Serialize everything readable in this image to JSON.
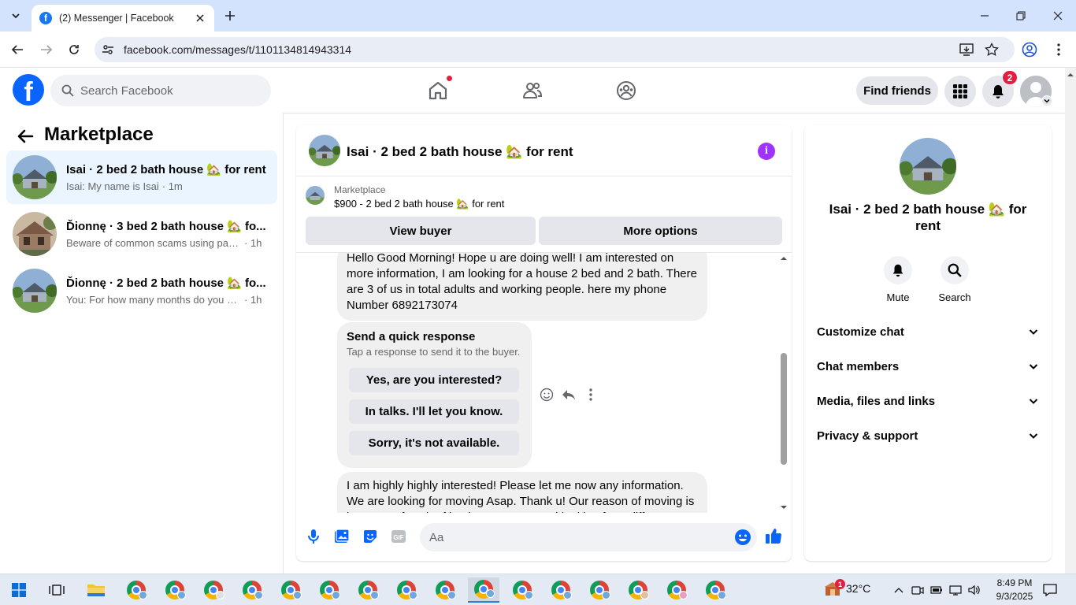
{
  "browser": {
    "tab_title": "(2) Messenger | Facebook",
    "url": "facebook.com/messages/t/1101134814943314"
  },
  "fb_header": {
    "search_placeholder": "Search Facebook",
    "find_friends_label": "Find friends",
    "notification_count": "2"
  },
  "left_panel": {
    "title": "Marketplace",
    "conversations": [
      {
        "name": "Isai · 2 bed 2 bath house 🏡 for rent",
        "preview": "Isai: My name is Isai",
        "time": "· 1m",
        "active": true
      },
      {
        "name": "Ďionnę · 3 bed 2 bath house 🏡 fo...",
        "preview": "Beware of common scams using pay...",
        "time": "· 1h",
        "active": false
      },
      {
        "name": "Ďionnę · 2 bed 2 bath house 🏡 fo...",
        "preview": "You: For how many months do you w...",
        "time": "· 1h",
        "active": false
      }
    ]
  },
  "chat": {
    "title": "Isai · 2 bed 2 bath house 🏡 for rent",
    "listing": {
      "label": "Marketplace",
      "title": "$900 - 2 bed 2 bath house 🏡 for rent",
      "view_buyer_label": "View buyer",
      "more_options_label": "More options"
    },
    "messages": [
      {
        "text": "Hello Good Morning! Hope u are doing well! I am interested on more information, I am looking for a house 2 bed and 2 bath. There are 3 of us in total adults and working people. here my phone Number 6892173074"
      },
      {
        "text": "I am highly highly interested! Please let me now any information. We are looking for moving Asap. Thank u! Our reason of moving is because of such of buying next gets and looking for a different"
      }
    ],
    "quick_response": {
      "title": "Send a quick response",
      "subtitle": "Tap a response to send it to the buyer.",
      "options": [
        "Yes, are you interested?",
        "In talks. I'll let you know.",
        "Sorry, it's not available."
      ]
    },
    "composer_placeholder": "Aa"
  },
  "right_panel": {
    "title": "Isai · 2 bed 2 bath house 🏡 for rent",
    "actions": [
      {
        "label": "Mute",
        "icon": "bell-icon"
      },
      {
        "label": "Search",
        "icon": "search-icon"
      }
    ],
    "sections": [
      "Customize chat",
      "Chat members",
      "Media, files and links",
      "Privacy & support"
    ]
  },
  "taskbar": {
    "weather_temp": "32°C",
    "weather_badge": "1",
    "time": "8:49 PM",
    "date": "9/3/2025"
  },
  "colors": {
    "fb_blue": "#0866ff",
    "messenger_purple": "#a033ff",
    "active_convo_bg": "#ebf5ff",
    "notification_red": "#e41e3f"
  }
}
